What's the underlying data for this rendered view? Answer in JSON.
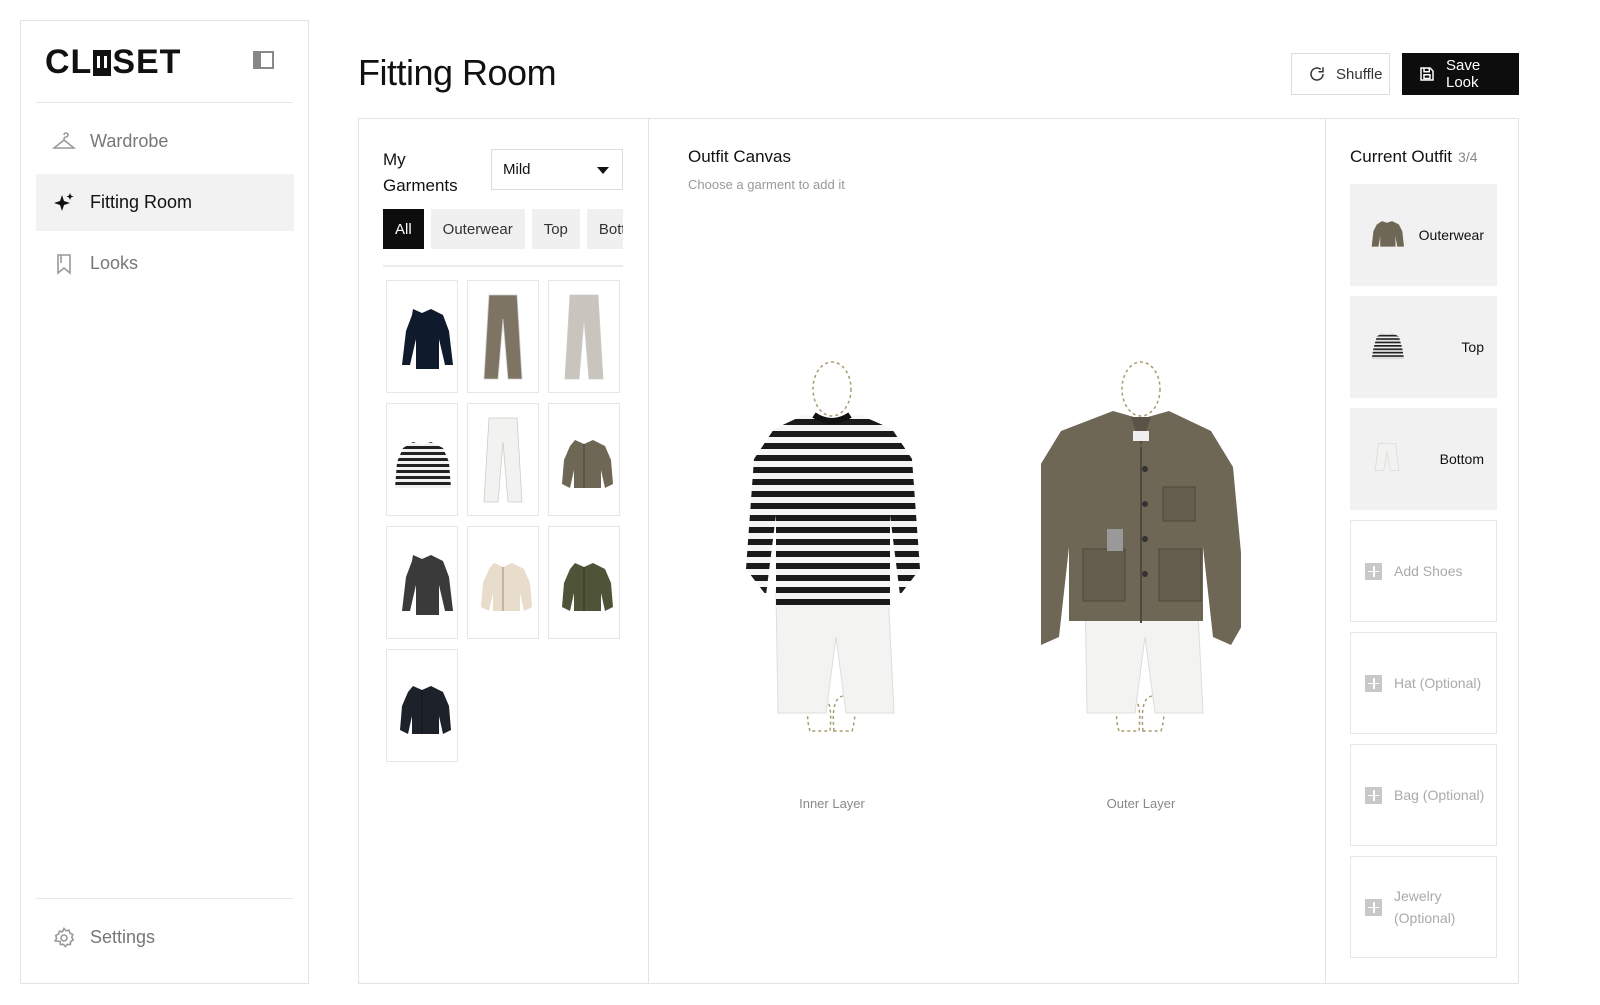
{
  "app": {
    "logo": "CL▮SET",
    "logo_pre": "CL",
    "logo_post": "SET"
  },
  "sidebar": {
    "items": [
      {
        "label": "Wardrobe",
        "icon": "hanger-icon"
      },
      {
        "label": "Fitting Room",
        "icon": "sparkle-icon",
        "active": true
      },
      {
        "label": "Looks",
        "icon": "bookmark-icon"
      }
    ],
    "settings": {
      "label": "Settings",
      "icon": "gear-icon"
    }
  },
  "header": {
    "title": "Fitting Room",
    "shuffle_label": "Shuffle",
    "save_label": "Save Look"
  },
  "garments": {
    "title": "My Garments",
    "weather_value": "Mild",
    "filters": [
      "All",
      "Outerwear",
      "Top",
      "Bottom"
    ],
    "active_filter": "All",
    "items": [
      {
        "name": "navy-long-sleeve-tee",
        "kind": "top",
        "color": "#0f1a2c"
      },
      {
        "name": "olive-trousers",
        "kind": "pants",
        "color": "#7d7463"
      },
      {
        "name": "beige-trousers",
        "kind": "pants",
        "color": "#c9c4bc"
      },
      {
        "name": "striped-sweater",
        "kind": "striped",
        "color": "#222222"
      },
      {
        "name": "white-wide-pants",
        "kind": "pants",
        "color": "#f2f2f0"
      },
      {
        "name": "olive-field-jacket",
        "kind": "jacket",
        "color": "#6e6755"
      },
      {
        "name": "charcoal-long-sleeve",
        "kind": "top",
        "color": "#3a3a3a"
      },
      {
        "name": "cream-blazer",
        "kind": "jacket",
        "color": "#e8dccb"
      },
      {
        "name": "green-shirt-jacket",
        "kind": "jacket",
        "color": "#4f5438"
      },
      {
        "name": "black-coach-jacket",
        "kind": "jacket",
        "color": "#1d2129"
      }
    ]
  },
  "canvas": {
    "title": "Outfit Canvas",
    "subtitle": "Choose a garment to add it",
    "inner_label": "Inner Layer",
    "outer_label": "Outer Layer"
  },
  "outfit": {
    "title": "Current Outfit",
    "count": "3/4",
    "filled": [
      {
        "label": "Outerwear",
        "thumb": "jacket",
        "color": "#6e6755"
      },
      {
        "label": "Top",
        "thumb": "striped",
        "color": "#222222"
      },
      {
        "label": "Bottom",
        "thumb": "pants",
        "color": "#f2f2f0"
      }
    ],
    "empty": [
      "Add Shoes",
      "Hat (Optional)",
      "Bag (Optional)",
      "Jewelry (Optional)"
    ]
  },
  "colors": {
    "accent": "#0d0d0d",
    "active_bg": "#f2f2f2",
    "muted": "#888888"
  }
}
